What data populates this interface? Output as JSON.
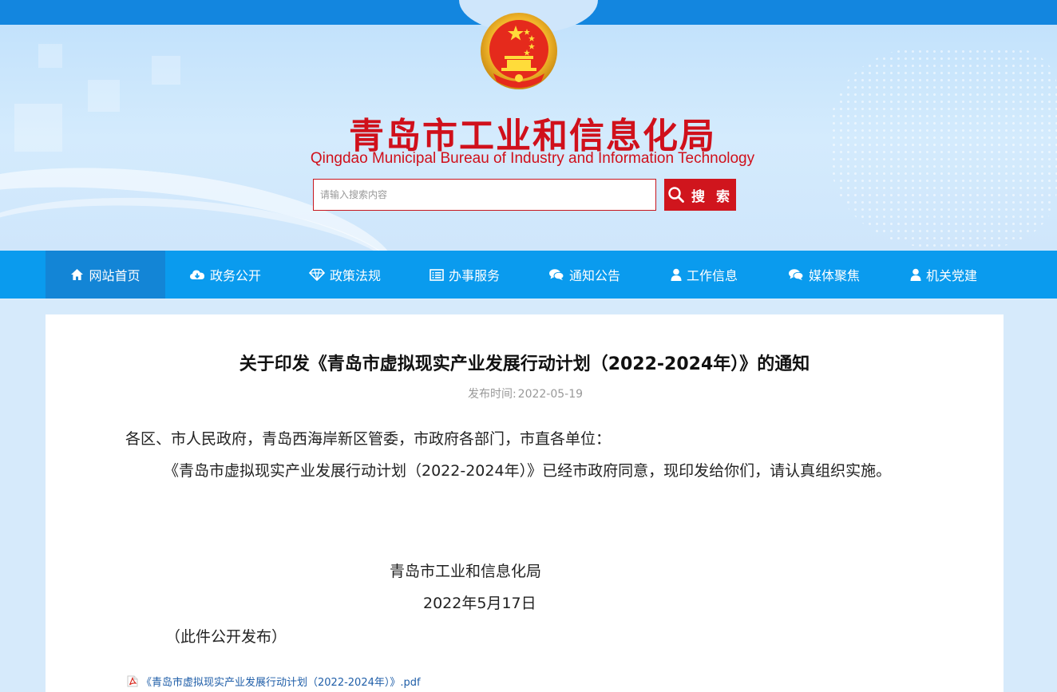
{
  "header": {
    "title": "青岛市工业和信息化局",
    "subtitle": "Qingdao Municipal Bureau of Industry and Information Technology",
    "search": {
      "placeholder": "请输入搜索内容",
      "button_label": "搜 索",
      "icon": "search-icon"
    },
    "emblem": "national-emblem",
    "colors": {
      "brand_red": "#d0101b",
      "top_band": "#1386df"
    }
  },
  "nav": {
    "colors": {
      "bar": "#0a9bee",
      "active": "#1385d6"
    },
    "items": [
      {
        "label": "网站首页",
        "icon": "home-icon",
        "active": true
      },
      {
        "label": "政务公开",
        "icon": "cloud-download-icon"
      },
      {
        "label": "政策法规",
        "icon": "diamond-icon"
      },
      {
        "label": "办事服务",
        "icon": "list-icon"
      },
      {
        "label": "通知公告",
        "icon": "chat-icon"
      },
      {
        "label": "工作信息",
        "icon": "user-icon"
      },
      {
        "label": "媒体聚焦",
        "icon": "chat-icon"
      },
      {
        "label": "机关党建",
        "icon": "user-icon"
      }
    ]
  },
  "article": {
    "title": "关于印发《青岛市虚拟现实产业发展行动计划（2022-2024年）》的通知",
    "date_label": "发布时间:",
    "date": "2022-05-19",
    "salutation": "各区、市人民政府，青岛西海岸新区管委，市政府各部门，市直各单位：",
    "paragraph": "《青岛市虚拟现实产业发展行动计划（2022-2024年）》已经市政府同意，现印发给你们，请认真组织实施。",
    "signature_org": "青岛市工业和信息化局",
    "signature_date": "2022年5月17日",
    "public_note": "（此件公开发布）",
    "attachment": {
      "label": "《青岛市虚拟现实产业发展行动计划（2022-2024年）》.pdf",
      "icon": "pdf-icon"
    }
  }
}
